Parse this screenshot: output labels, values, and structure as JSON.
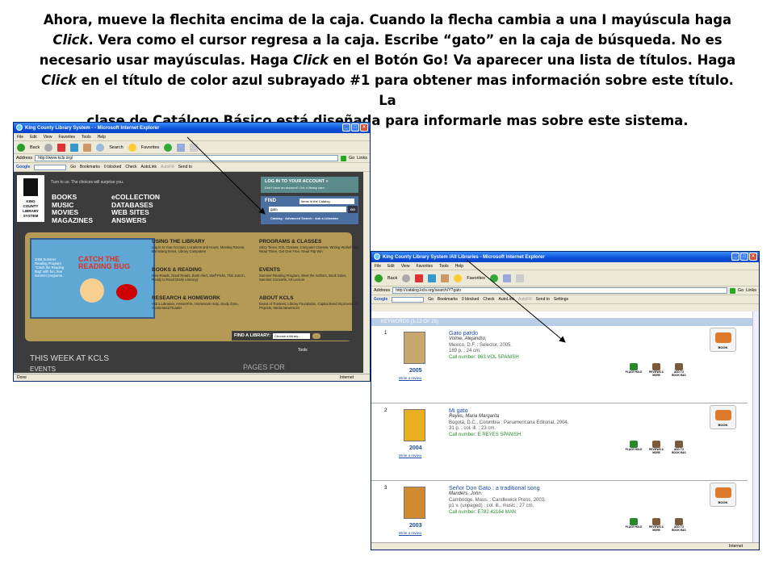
{
  "instructions": {
    "line1": "Ahora, mueve la flechita encima de la caja. Cuando la flecha cambia a una I mayúscula haga",
    "line2_a": "Click",
    "line2_b": ". Vera como el cursor regresa a la caja.  Escribe “gato” en la caja de búsqueda.  No es",
    "line3_a": "necesario usar mayúsculas.  Haga ",
    "line3_b": "Click",
    "line3_c": " en el Botón Go! Va aparecer una lista de títulos.  Haga",
    "line4_a": "Click",
    "line4_b": " en el título de color azul subrayado #1 para obtener mas información sobre este título. La",
    "line5": "clase de Catálogo Básico está diseñada para informarle mas sobre este sistema."
  },
  "browser1": {
    "title": "King County Library System - - Microsoft Internet Explorer",
    "menu": [
      "File",
      "Edit",
      "View",
      "Favorites",
      "Tools",
      "Help"
    ],
    "toolbar": [
      "Back",
      "Search",
      "Favorites"
    ],
    "address_label": "Address",
    "address": "http://www.kcls.org/",
    "go": "Go",
    "links": "Links",
    "google_label": "Google",
    "google_items": [
      "Go",
      "Bookmarks",
      "0 blocked",
      "Check",
      "AutoLink",
      "AutoFill",
      "Send to"
    ],
    "status_left": "Done",
    "status_right": "Internet",
    "page": {
      "logo": [
        "KING",
        "COUNTY",
        "LIBRARY",
        "SYSTEM"
      ],
      "tagline": "Turn to us. The choices will surprise you.",
      "col1": [
        "BOOKS",
        "MUSIC",
        "MOVIES",
        "MAGAZINES"
      ],
      "col2": [
        "eCOLLECTION",
        "DATABASES",
        "WEB SITES",
        "ANSWERS"
      ],
      "login_title": "LOG IN TO YOUR ACCOUNT »",
      "login_sub": "Don't have an account? Get a library card",
      "find_label": "FIND",
      "find_select": "Items in the Catalog",
      "find_query": "gato",
      "find_go": "GO",
      "find_links": "Catalog · Advanced Search · Ask a Librarian",
      "promo_text": "2008 Summer Reading Program \"Catch the Reading Bug\" with fun, free summer programs.",
      "promo_headline": "CATCH THE READING BUG",
      "sections": [
        {
          "title": "USING THE LIBRARY",
          "text": "Log in to Your Account, Locations and Hours, Meeting Rooms, Borrowing Items, Library Computers"
        },
        {
          "title": "PROGRAMS & CLASSES",
          "text": "Story Times, ESL Classes, Computer Classes, Writing Workshops, Read Three, Get One Free, Read Flip Win"
        },
        {
          "title": "BOOKS & READING",
          "text": "New Reads, Good Reads, Book Alert, Staff Picks, This Just In, Ready to Read (Early Literacy)"
        },
        {
          "title": "EVENTS",
          "text": "Summer Reading Program, Meet the Authors, Book Sales, Summer Concerts, Art Lecture"
        },
        {
          "title": "RESEARCH & HOMEWORK",
          "text": "Ask a Librarian, AnswerFile, Homework Help, Study Zone, Accelerated Reader"
        },
        {
          "title": "ABOUT KCLS",
          "text": "Board of Trustees, Library Foundation, Capital Bond Improvement Projects, Media Newsroom"
        }
      ],
      "find_library": "FIND A LIBRARY:",
      "find_library_select": "Choose a library...",
      "tools": "Tools",
      "this_week": "THIS WEEK AT KCLS",
      "events": "EVENTS",
      "pages_for": "PAGES FOR"
    }
  },
  "browser2": {
    "title": "King County Library System /All Libraries - Microsoft Internet Explorer",
    "menu": [
      "File",
      "Edit",
      "View",
      "Favorites",
      "Tools",
      "Help"
    ],
    "toolbar": [
      "Back",
      "Favorites"
    ],
    "address_label": "Address",
    "address": "http://catalog.kcls.org/search/Y?gato",
    "go": "Go",
    "links": "Links",
    "google_label": "Google",
    "google_items": [
      "Go",
      "Bookmarks",
      "0 blocked",
      "Check",
      "AutoLink",
      "AutoFill",
      "Send to",
      "Settings"
    ],
    "results_header": "KEYWORDS (1-12 OF 26)",
    "write_review": "Write a review",
    "actions": [
      "PLACE HOLD",
      "REVIEWS & MORE",
      "ADD TO BOOK BAG"
    ],
    "format": "BOOK",
    "status_right": "Internet",
    "results": [
      {
        "num": "1",
        "title": "Gato pardo",
        "author": "Volnie, Alejandro,",
        "pub": "Mexico, D.F. : Selector, 2005.",
        "desc": "189 p. ; 24 cm.",
        "call": "Call number: 863 VOL SPANISH",
        "year": "2005",
        "cover": "#c9a870"
      },
      {
        "num": "2",
        "title": "Mi gato",
        "author": "Reyes, Maria Margarita",
        "pub": "Bogotá, D.C., Colombia : Panamericana Editorial, 2004.",
        "desc": "31 p. : col. ill. ; 23 cm.",
        "call": "Call number: E REYES SPANISH",
        "year": "2004",
        "cover": "#e8b020"
      },
      {
        "num": "3",
        "title": "Señor Don Gato : a traditional song",
        "author": "Manders, John.",
        "pub": "Cambridge, Mass. : Candlewick Press, 2003.",
        "desc": "p1 v. (unpaged) : col. ill., music ; 27 cm.",
        "call": "Call number: E782.42164 MAN",
        "year": "2003",
        "cover": "#d08a30"
      }
    ]
  }
}
